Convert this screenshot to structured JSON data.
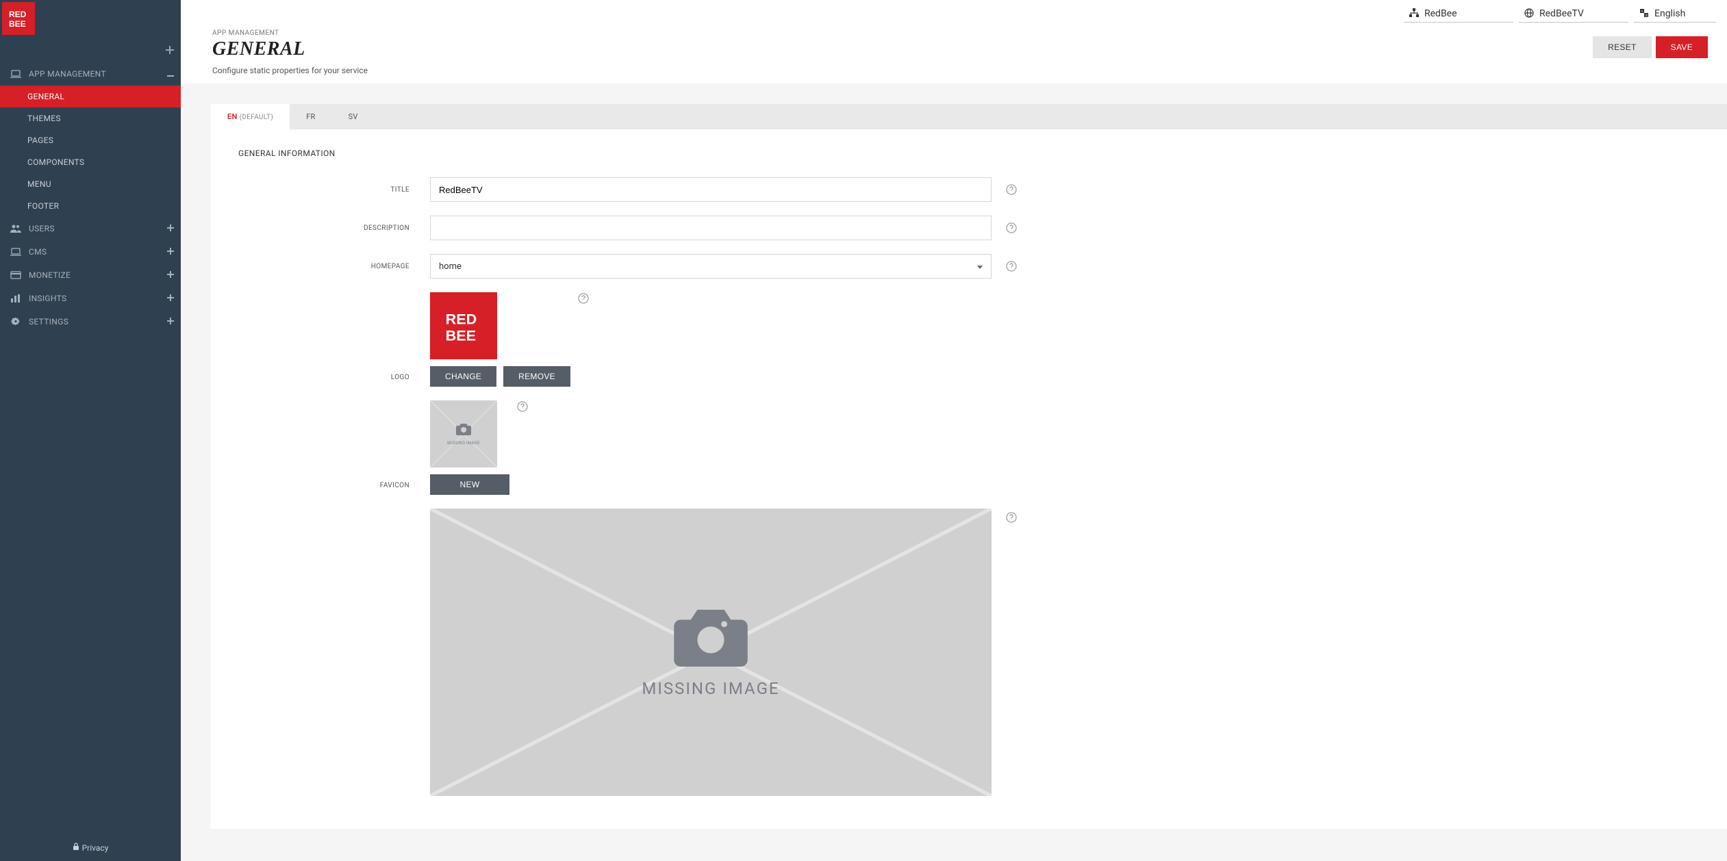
{
  "brand": {
    "logo_text_1": "RED",
    "logo_text_2": "BEE"
  },
  "sidebar": {
    "app_management": "APP MANAGEMENT",
    "sub": {
      "general": "GENERAL",
      "themes": "THEMES",
      "pages": "PAGES",
      "components": "COMPONENTS",
      "menu": "MENU",
      "footer": "FOOTER"
    },
    "users": "USERS",
    "cms": "CMS",
    "monetize": "MONETIZE",
    "insights": "INSIGHTS",
    "settings": "SETTINGS",
    "privacy": "Privacy"
  },
  "topbar": {
    "org": "RedBee",
    "product": "RedBeeTV",
    "language": "English"
  },
  "header": {
    "breadcrumb": "APP MANAGEMENT",
    "title": "GENERAL",
    "desc": "Configure static properties for your service",
    "reset": "RESET",
    "save": "SAVE"
  },
  "tabs": {
    "en_code": "EN",
    "en_default": "(DEFAULT)",
    "fr": "FR",
    "sv": "SV"
  },
  "form": {
    "section_title": "GENERAL INFORMATION",
    "title_label": "TITLE",
    "title_value": "RedBeeTV",
    "description_label": "DESCRIPTION",
    "description_value": "",
    "homepage_label": "HOMEPAGE",
    "homepage_value": "home",
    "logo_label": "LOGO",
    "change": "CHANGE",
    "remove": "REMOVE",
    "favicon_label": "FAVICON",
    "new": "NEW",
    "missing_image_sm": "MISSING IMAGE",
    "missing_image_lg": "MISSING IMAGE"
  }
}
